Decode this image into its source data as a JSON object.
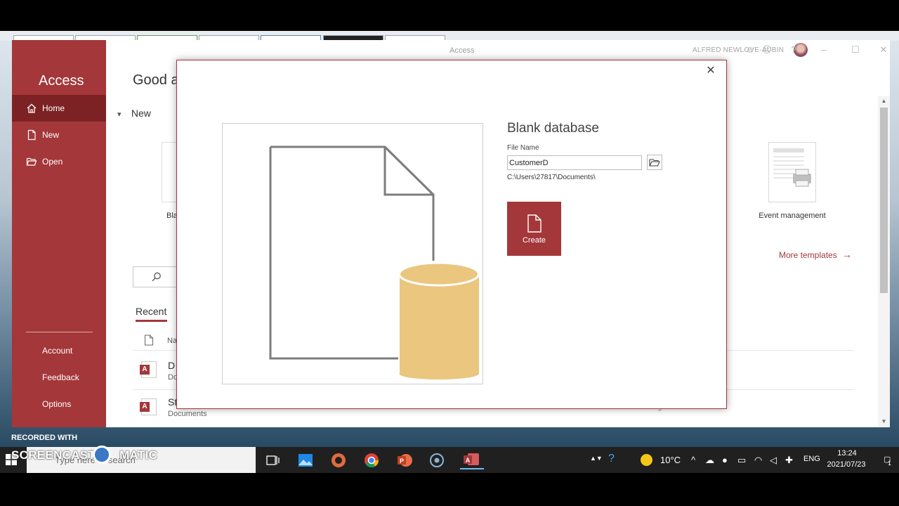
{
  "window": {
    "title": "Access",
    "user_name": "ALFRED NEWLOVE-AUBIN",
    "help": "?"
  },
  "sidebar": {
    "app_name": "Access",
    "items": [
      {
        "label": "Home",
        "icon": "home-icon",
        "active": true
      },
      {
        "label": "New",
        "icon": "new-document-icon",
        "active": false
      },
      {
        "label": "Open",
        "icon": "folder-open-icon",
        "active": false
      }
    ],
    "footer": [
      {
        "label": "Account"
      },
      {
        "label": "Feedback"
      },
      {
        "label": "Options"
      }
    ]
  },
  "main": {
    "greeting": "Good a",
    "new_section": "New",
    "templates": [
      {
        "label": "Bla"
      },
      {
        "label": "Event management"
      }
    ],
    "more_templates": "More templates",
    "recent_tab": "Recent",
    "column_name": "Na",
    "recent_items": [
      {
        "name": "D",
        "location": "Do"
      },
      {
        "name": "St",
        "location": "Documents"
      }
    ],
    "recent_time": "1h ago"
  },
  "dialog": {
    "title": "Blank database",
    "file_name_label": "File Name",
    "file_name_value": "CustomerD",
    "path": "C:\\Users\\27817\\Documents\\",
    "create_label": "Create",
    "colors": {
      "accent": "#a4373a",
      "cylinder": "#eac67e"
    }
  },
  "taskbar": {
    "search_placeholder": "Type here to search",
    "apps": [
      "task-view-icon",
      "photos-icon",
      "media-icon",
      "chrome-icon",
      "powerpoint-icon",
      "cortana-icon",
      "access-icon"
    ],
    "temperature": "10°C",
    "language": "ENG",
    "time": "13:24",
    "date": "2021/07/23",
    "notifications": "1"
  },
  "watermark": {
    "recorded_with": "RECORDED WITH",
    "brand": "SCREENCAST",
    "brand_suffix": "MATIC"
  }
}
